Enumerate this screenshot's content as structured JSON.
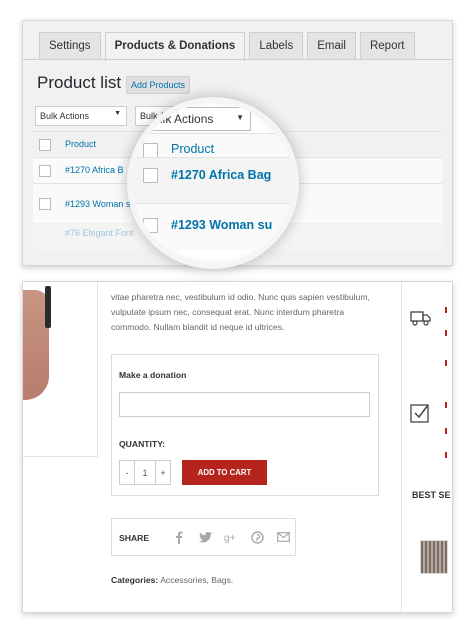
{
  "admin": {
    "tabs": [
      "Settings",
      "Products & Donations",
      "Labels",
      "Email",
      "Report"
    ],
    "active_tab": "Products & Donations",
    "title": "Product list",
    "add_button": "Add Products",
    "bulk_actions": "Bulk Actions",
    "column_product": "Product",
    "rows": [
      "#1270 Africa B",
      "#1293 Woman s",
      "#76 Elegant Font"
    ]
  },
  "magnifier": {
    "bulk_actions": "Bulk Actions",
    "column_product": "Product",
    "rows": [
      "#1270 Africa Bag",
      "#1293 Woman su"
    ]
  },
  "product": {
    "description": "vitae pharetra nec, vestibulum id odio. Nunc quis sapien vestibulum, vulputate ipsum nec, consequat erat. Nunc interdum pharetra commodo. Nullam blandit id neque id ultrices.",
    "donation_label": "Make a donation",
    "quantity_label": "QUANTITY:",
    "qty_minus": "-",
    "qty_value": "1",
    "qty_plus": "+",
    "add_to_cart": "ADD TO CART",
    "share_label": "SHARE",
    "share_icons": [
      "facebook-icon",
      "twitter-icon",
      "google-plus-icon",
      "pinterest-icon",
      "email-icon"
    ],
    "categories_label": "Categories:",
    "categories_value": " Accessories, Bags.",
    "sidebar_title": "BEST SE",
    "accent_color": "#b5251e"
  }
}
